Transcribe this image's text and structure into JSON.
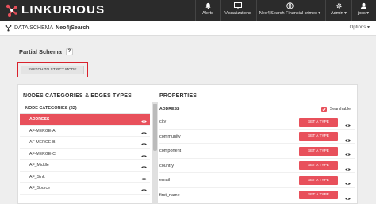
{
  "navbar": {
    "brand": "LINKURIOUS",
    "items": [
      {
        "label": "Alerts",
        "icon": "bell-icon"
      },
      {
        "label": "Visualizations",
        "icon": "monitor-icon"
      },
      {
        "label": "Neo4jSearch Financial crimes",
        "icon": "globe-icon"
      },
      {
        "label": "Admin",
        "icon": "gear-icon"
      },
      {
        "label": "joss",
        "icon": "user-icon"
      }
    ]
  },
  "subheader": {
    "section": "DATA SCHEMA",
    "source_name": "Neo4jSearch",
    "options_label": "Options"
  },
  "schema": {
    "title": "Partial Schema",
    "help_label": "?",
    "switch_button_label": "SWITCH TO STRICT MODE"
  },
  "left_panel": {
    "title": "NODES CATEGORIES & EDGES TYPES",
    "list_header": "NODE CATEGORIES (22)",
    "items": [
      {
        "label": "ADDRESS",
        "active": true
      },
      {
        "label": "AF-MERGE-A",
        "active": false
      },
      {
        "label": "AF-MERGE-B",
        "active": false
      },
      {
        "label": "AF-MERGE-C",
        "active": false
      },
      {
        "label": "AF_Middle",
        "active": false
      },
      {
        "label": "AF_Sink",
        "active": false
      },
      {
        "label": "AF_Source",
        "active": false
      }
    ]
  },
  "right_panel": {
    "title": "PROPERTIES",
    "category": "ADDRESS",
    "searchable_label": "Searchable",
    "set_type_label": "SET A TYPE",
    "properties": [
      {
        "name": "city"
      },
      {
        "name": "community"
      },
      {
        "name": "component"
      },
      {
        "name": "country"
      },
      {
        "name": "email"
      },
      {
        "name": "first_name"
      }
    ]
  },
  "colors": {
    "accent": "#e8505b",
    "navbar": "#2b2b2b",
    "highlight_border": "#d9222c"
  }
}
